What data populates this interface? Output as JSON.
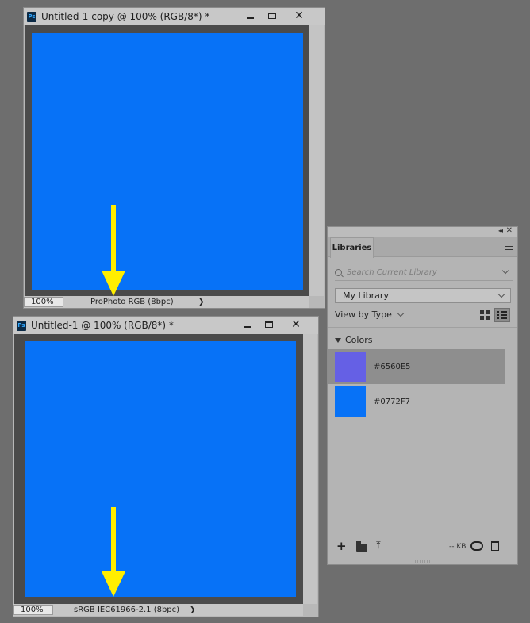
{
  "window_top": {
    "title": "Untitled-1 copy @ 100% (RGB/8*) *",
    "app_icon": "Ps",
    "zoom": "100%",
    "color_profile": "ProPhoto RGB (8bpc)",
    "status_arrow": "❯",
    "canvas_color": "#0772F7"
  },
  "window_bottom": {
    "title": "Untitled-1 @ 100% (RGB/8*) *",
    "app_icon": "Ps",
    "zoom": "100%",
    "color_profile": "sRGB IEC61966-2.1 (8bpc)",
    "status_arrow": "❯",
    "canvas_color": "#0772F7"
  },
  "window_buttons": {
    "minimize_icon": "minimize-icon",
    "maximize_icon": "maximize-icon",
    "close_glyph": "✕"
  },
  "annotation_color": "#FFEE00",
  "libraries_panel": {
    "collapse_glyph": "◂◂",
    "close_glyph": "✕",
    "tab_label": "Libraries",
    "search_placeholder": "Search Current Library",
    "library_select": "My Library",
    "view_by": "View by Type",
    "section_title": "Colors",
    "colors": [
      {
        "label": "#6560E5",
        "hex": "#6560E5",
        "selected": true
      },
      {
        "label": "#0772F7",
        "hex": "#0772F7",
        "selected": false
      }
    ],
    "footer": {
      "add_glyph": "+",
      "upload_glyph": "⤒",
      "storage_text": "-- KB"
    }
  }
}
